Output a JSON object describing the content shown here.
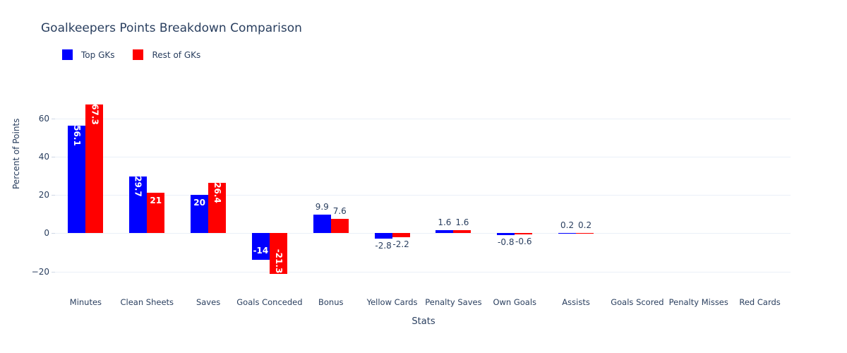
{
  "chart_data": {
    "type": "bar",
    "title": "Goalkeepers Points Breakdown Comparison",
    "xlabel": "Stats",
    "ylabel": "Percent of Points",
    "ylim": [
      -26,
      72
    ],
    "yticks": [
      -20,
      0,
      20,
      40,
      60
    ],
    "ytick_labels": [
      "−20",
      "0",
      "20",
      "40",
      "60"
    ],
    "grid": true,
    "legend_position": "top-left",
    "barmode": "group",
    "categories": [
      "Minutes",
      "Clean Sheets",
      "Saves",
      "Goals Conceded",
      "Bonus",
      "Yellow Cards",
      "Penalty Saves",
      "Own Goals",
      "Assists",
      "Goals Scored",
      "Penalty Misses",
      "Red Cards"
    ],
    "series": [
      {
        "name": "Top GKs",
        "color": "#0000ff",
        "values": [
          56.1,
          29.7,
          20,
          -14,
          9.9,
          -2.8,
          1.6,
          -0.8,
          0.2,
          0,
          0,
          0
        ],
        "labels": [
          "56.1",
          "29.7",
          "20",
          "-14",
          "9.9",
          "-2.8",
          "1.6",
          "-0.8",
          "0.2",
          "",
          "",
          ""
        ]
      },
      {
        "name": "Rest of GKs",
        "color": "#ff0000",
        "values": [
          67.3,
          21,
          26.4,
          -21.3,
          7.6,
          -2.2,
          1.6,
          -0.6,
          0.2,
          0,
          0,
          0
        ],
        "labels": [
          "67.3",
          "21",
          "26.4",
          "-21.3",
          "7.6",
          "-2.2",
          "1.6",
          "-0.6",
          "0.2",
          "",
          "",
          ""
        ]
      }
    ]
  },
  "legend": {
    "items": [
      {
        "label": "Top GKs",
        "color": "#0000ff"
      },
      {
        "label": "Rest of GKs",
        "color": "#ff0000"
      }
    ]
  },
  "colors": {
    "top_gks": "#0000ff",
    "rest_of_gks": "#ff0000",
    "text": "#2a3f5f",
    "grid": "#eaf0f8",
    "background": "#ffffff"
  }
}
